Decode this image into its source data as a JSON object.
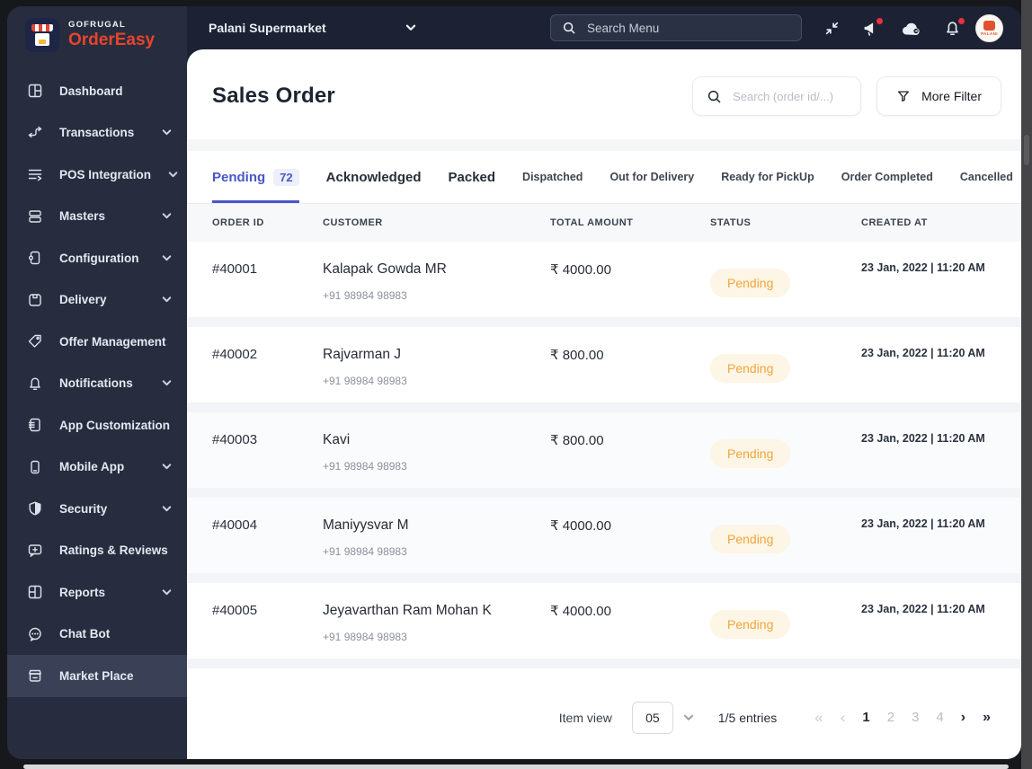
{
  "brand": {
    "company": "GOFRUGAL",
    "product": "OrderEasy",
    "logo_icon": "storefront-logo-icon"
  },
  "topbar": {
    "store_selector": {
      "label": "Palani Supermarket",
      "icon": "chevron-down-icon"
    },
    "search": {
      "placeholder": "Search Menu",
      "icon": "search-icon"
    },
    "icons": [
      "collapse-icon",
      "announcement-icon",
      "cloud-sync-icon",
      "notification-bell-icon"
    ],
    "avatar_label": "PALANI"
  },
  "sidebar": {
    "items": [
      {
        "label": "Dashboard",
        "icon": "dashboard-icon",
        "expandable": false
      },
      {
        "label": "Transactions",
        "icon": "transactions-icon",
        "expandable": true
      },
      {
        "label": "POS Integration",
        "icon": "pos-integration-icon",
        "expandable": true
      },
      {
        "label": "Masters",
        "icon": "masters-icon",
        "expandable": true
      },
      {
        "label": "Configuration",
        "icon": "configuration-icon",
        "expandable": true
      },
      {
        "label": "Delivery",
        "icon": "delivery-icon",
        "expandable": true
      },
      {
        "label": "Offer Management",
        "icon": "offer-tag-icon",
        "badge": "offers-red-badge",
        "expandable": false
      },
      {
        "label": "Notifications",
        "icon": "notifications-icon",
        "expandable": true
      },
      {
        "label": "App Customization",
        "icon": "app-customization-icon",
        "expandable": true
      },
      {
        "label": "Mobile App",
        "icon": "mobile-app-icon",
        "expandable": true
      },
      {
        "label": "Security",
        "icon": "security-icon",
        "expandable": true
      },
      {
        "label": "Ratings & Reviews",
        "icon": "ratings-reviews-icon",
        "expandable": false
      },
      {
        "label": "Reports",
        "icon": "reports-icon",
        "expandable": true
      },
      {
        "label": "Chat Bot",
        "icon": "chat-bot-icon",
        "expandable": false
      },
      {
        "label": "Market Place",
        "icon": "market-place-icon",
        "expandable": false,
        "active": true
      }
    ]
  },
  "page": {
    "title": "Sales Order",
    "search_placeholder": "Search (order id/...)",
    "more_filter_label": "More Filter",
    "tabs": [
      {
        "label": "Pending",
        "count": "72",
        "active": true
      },
      {
        "label": "Acknowledged"
      },
      {
        "label": "Packed"
      },
      {
        "label": "Dispatched"
      },
      {
        "label": "Out for Delivery"
      },
      {
        "label": "Ready for PickUp"
      },
      {
        "label": "Order Completed"
      },
      {
        "label": "Cancelled"
      }
    ],
    "table": {
      "columns": [
        "ORDER ID",
        "CUSTOMER",
        "TOTAL AMOUNT",
        "STATUS",
        "CREATED AT"
      ],
      "rows": [
        {
          "id": "#40001",
          "customer": "Kalapak Gowda MR",
          "phone": "+91 98984 98983",
          "amount": "₹ 4000.00",
          "status": "Pending",
          "created": "23 Jan, 2022 | 11:20 AM"
        },
        {
          "id": "#40002",
          "customer": "Rajvarman J",
          "phone": "+91 98984 98983",
          "amount": "₹ 800.00",
          "status": "Pending",
          "created": "23 Jan, 2022 | 11:20 AM"
        },
        {
          "id": "#40003",
          "customer": "Kavi",
          "phone": "+91 98984 98983",
          "amount": "₹ 800.00",
          "status": "Pending",
          "created": "23 Jan, 2022 | 11:20 AM"
        },
        {
          "id": "#40004",
          "customer": "Maniyysvar M",
          "phone": "+91 98984 98983",
          "amount": "₹ 4000.00",
          "status": "Pending",
          "created": "23 Jan, 2022 | 11:20 AM"
        },
        {
          "id": "#40005",
          "customer": "Jeyavarthan Ram Mohan K",
          "phone": "+91 98984 98983",
          "amount": "₹ 4000.00",
          "status": "Pending",
          "created": "23 Jan, 2022 | 11:20 AM"
        }
      ]
    },
    "pagination": {
      "item_view_label": "Item view",
      "page_size": "05",
      "entries_text": "1/5 entries",
      "first": "«",
      "prev": "‹",
      "pages": [
        "1",
        "2",
        "3",
        "4"
      ],
      "next": "›",
      "last": "»"
    }
  },
  "colors": {
    "accent": "#4a56c8",
    "pending_text": "#f0a63c",
    "pending_bg": "#fdf5e5",
    "sidebar_bg": "#272d3e",
    "topbar_bg": "#1c2233",
    "badge_red": "#e8323e",
    "brand_red": "#e8442e"
  }
}
